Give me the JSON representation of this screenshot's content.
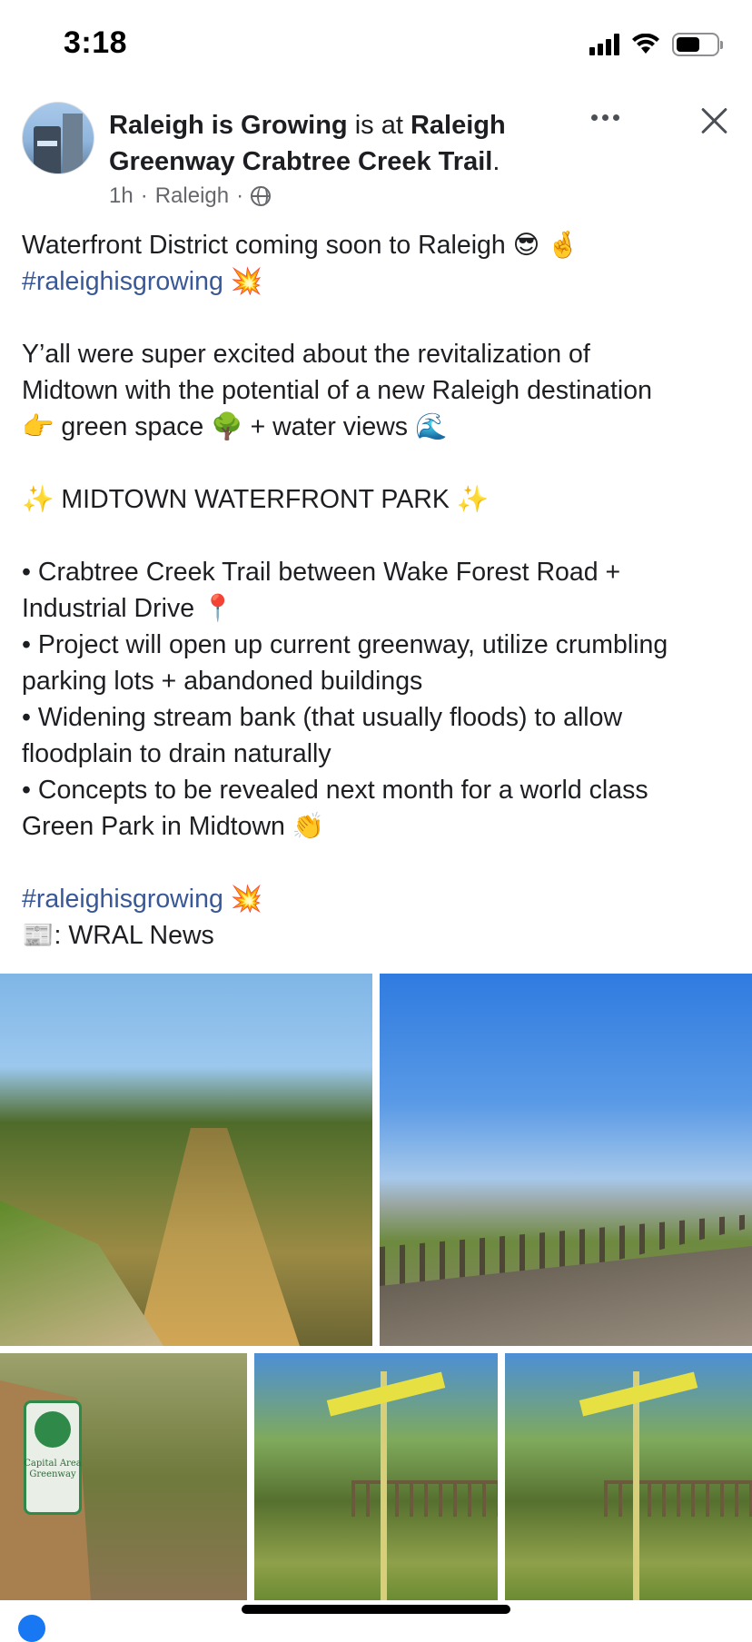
{
  "status_bar": {
    "time": "3:18",
    "battery_level": 0.6
  },
  "post": {
    "author": "Raleigh is Growing",
    "at_text": " is at ",
    "location": "Raleigh Greenway Crabtree Creek Trail",
    "period": ".",
    "time_ago": "1h",
    "separator": "·",
    "place": "Raleigh",
    "visibility_icon": "globe-icon",
    "more_icon": "more-icon",
    "close_icon": "close-icon"
  },
  "body": {
    "l1": "Waterfront District coming soon to Raleigh 😎 🤞",
    "l2_hashtag": "#raleighisgrowing",
    "l2_emoji": "💥",
    "l3": "Y’all were super excited about the revitalization of",
    "l4": "Midtown with the potential of a new Raleigh destination",
    "l5": "👉 green space 🌳 + water views 🌊",
    "l6": "✨ MIDTOWN WATERFRONT PARK ✨",
    "l7": "• Crabtree Creek Trail between Wake Forest Road +",
    "l8": "Industrial Drive 📍",
    "l9": "• Project will open up current greenway, utilize crumbling",
    "l10": "parking lots + abandoned buildings",
    "l11": "• Widening stream bank (that usually floods) to allow",
    "l12": "floodplain to drain naturally",
    "l13": "• Concepts to be revealed next month for a world class",
    "l14": "Green Park in Midtown 👏",
    "l15_hashtag": "#raleighisgrowing",
    "l15_emoji": "💥",
    "l16": "📰: WRAL News"
  },
  "photos": {
    "sign_text": "Capital Area Greenway"
  }
}
